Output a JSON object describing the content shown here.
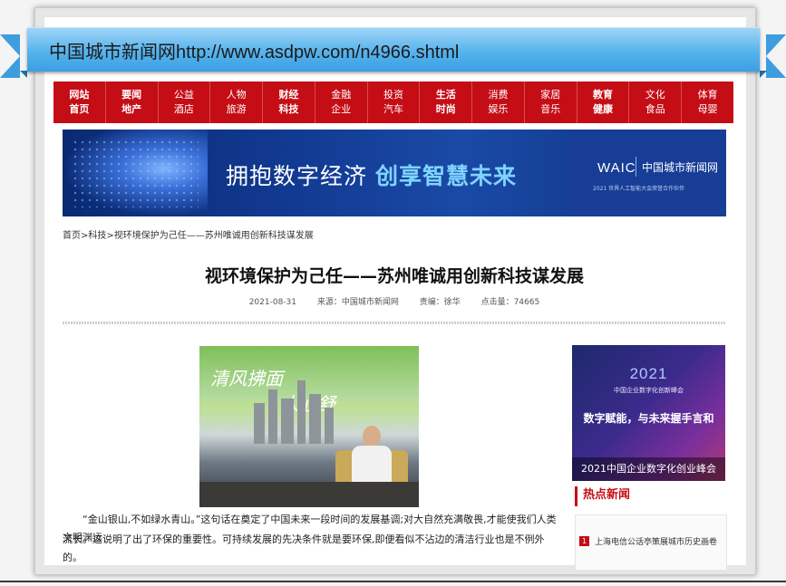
{
  "header": {
    "site_name": "中国城市新闻网",
    "url": "http://www.asdpw.com/n4966.shtml"
  },
  "nav": [
    {
      "top": "网站",
      "bottom": "首页",
      "bold": true
    },
    {
      "top": "要闻",
      "bottom": "地产",
      "bold": true
    },
    {
      "top": "公益",
      "bottom": "酒店",
      "bold": false
    },
    {
      "top": "人物",
      "bottom": "旅游",
      "bold": false
    },
    {
      "top": "财经",
      "bottom": "科技",
      "bold": true
    },
    {
      "top": "金融",
      "bottom": "企业",
      "bold": false
    },
    {
      "top": "投资",
      "bottom": "汽车",
      "bold": false
    },
    {
      "top": "生活",
      "bottom": "时尚",
      "bold": true
    },
    {
      "top": "消费",
      "bottom": "娱乐",
      "bold": false
    },
    {
      "top": "家居",
      "bottom": "音乐",
      "bold": false
    },
    {
      "top": "教育",
      "bottom": "健康",
      "bold": true
    },
    {
      "top": "文化",
      "bottom": "食品",
      "bold": false
    },
    {
      "top": "体育",
      "bottom": "母婴",
      "bold": false
    }
  ],
  "banner": {
    "title_plain": "拥抱数字经济",
    "title_highlight": "创享智慧未来",
    "waic": "WAIC",
    "brand": "中国城市新闻网",
    "subtitle": "2021 世界人工智能大会荣誉合作伙伴"
  },
  "breadcrumb": [
    "首页",
    "科技",
    "视环境保护为己任——苏州唯诚用创新科技谋发展"
  ],
  "article": {
    "title": "视环境保护为己任——苏州唯诚用创新科技谋发展",
    "date": "2021-08-31",
    "source": "来源：中国城市新闻网",
    "editor": "责编：徐华",
    "clicks": "点击量：74665",
    "photo_text_1": "清风拂面",
    "photo_text_2": "人心舒",
    "para_1": "“金山银山,不如绿水青山。”这句话在奠定了中国未来一段时间的发展基调;对大自然充满敬畏,才能使我们人类文明渊远",
    "para_2": "流长。这说明了出了环保的重要性。可持续发展的先决条件就是要环保,即便看似不沾边的清洁行业也是不例外的。"
  },
  "sidebar": {
    "ad_year": "2021",
    "ad_small": "中国企业数字化创新峰会",
    "ad_main": "数字赋能，与未来握手言和",
    "ad_caption": "2021中国企业数字化创业峰会",
    "hot_title": "热点新闻",
    "hot_items": [
      {
        "rank": "1",
        "text": "上海电信公话亭策展城市历史画卷"
      }
    ]
  }
}
